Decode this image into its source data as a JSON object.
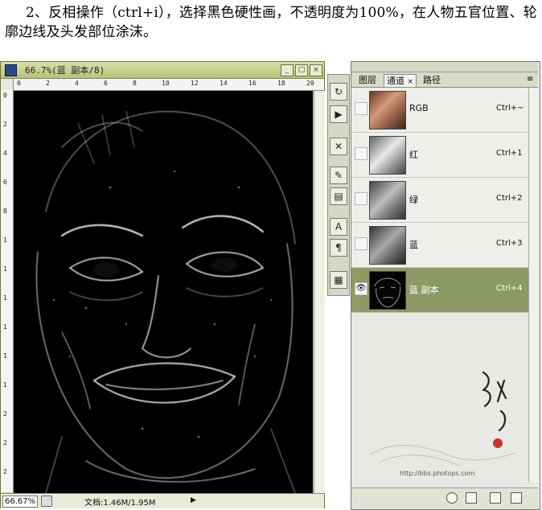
{
  "caption": "2、反相操作（ctrl+i），选择黑色硬性画，不透明度为100%，在人物五官位置、轮廓边线及头发部位涂沫。",
  "document": {
    "title": "66.7%(蓝 副本/8)",
    "zoom": "66.67%",
    "doc_info": "文档:1.46M/1.95M",
    "ruler_top_labels": [
      "0",
      "2",
      "4",
      "6",
      "8",
      "10",
      "12",
      "14",
      "16",
      "18",
      "20"
    ],
    "ruler_left_labels": [
      "0",
      "2",
      "4",
      "6",
      "8",
      "1",
      "1",
      "1",
      "1",
      "1",
      "1",
      "2",
      "2",
      "2"
    ]
  },
  "panel": {
    "tabs": [
      "图层",
      "通道",
      "路径"
    ],
    "active_tab": "通道",
    "channels": [
      {
        "name": "RGB",
        "shortcut": "Ctrl+~",
        "visible": false
      },
      {
        "name": "红",
        "shortcut": "Ctrl+1",
        "visible": false
      },
      {
        "name": "绿",
        "shortcut": "Ctrl+2",
        "visible": false
      },
      {
        "name": "蓝",
        "shortcut": "Ctrl+3",
        "visible": false
      },
      {
        "name": "蓝 副本",
        "shortcut": "Ctrl+4",
        "visible": true,
        "selected": true
      }
    ]
  },
  "watermark": {
    "url": "http://bbs.photops.com"
  },
  "colors": {
    "doc_frame": "#c9d197",
    "selected_row": "#8d9a65",
    "canvas": "#000000"
  }
}
